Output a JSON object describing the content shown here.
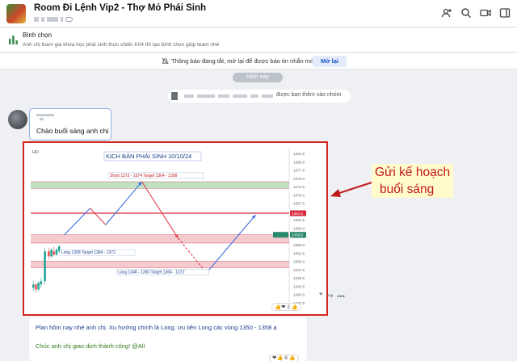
{
  "header": {
    "title": "Room Đi Lệnh Vip2 - Thợ Mỏ Phái Sinh",
    "icons": [
      "add-member-icon",
      "search-icon",
      "video-call-icon",
      "sidebar-toggle-icon"
    ]
  },
  "poll": {
    "title": "Bình chọn",
    "description": "Anh chị tham gia khóa học phái sinh thực chiến K04 thì tạo bình chọn giúp team nhé"
  },
  "notice": {
    "text": "Thông báo đang tắt, mở lại để được báo tin nhắn mới",
    "button": "Mở lại"
  },
  "chat": {
    "date_pill": "Hôm nay",
    "system_message": "được bạn thêm vào nhóm",
    "greeting": "Chào buổi sáng anh chị",
    "annotation": {
      "line1": "Gửi kế hoạch",
      "line2": "buổi sáng"
    },
    "image_reaction": "2",
    "plan_message": "Plan hôm nay nhé anh chị. Xu hướng chính là Long. ưu tiên Long các vùng 1350 - 1358 ạ",
    "wish_message": "Chúc anh chị giao dịch thành công! @All",
    "plan_reaction": "6"
  },
  "chart_data": {
    "type": "line",
    "title": "KỊCH BẢN PHÁI SINH 10/10/24",
    "ylim": [
      1336,
      1384
    ],
    "y_ticks": [
      "1382.5",
      "1380.0",
      "1377.5",
      "1375.0",
      "1372.5",
      "1370.0",
      "1367.5",
      "1365.0",
      "1362.5",
      "1360.0",
      "1357.5",
      "1355.0",
      "1352.5",
      "1350.0",
      "1347.5",
      "1345.0",
      "1342.5",
      "1340.0",
      "1337.5"
    ],
    "price_tags": [
      {
        "label": "1364.5",
        "value": 1364.5,
        "color": "#d8283a"
      },
      {
        "label": "1358.0",
        "value": 1358.0,
        "color": "#2b8a6e"
      }
    ],
    "zones": [
      {
        "name": "Short 1372 - 1374  Target  1364 - 1358",
        "from": 1372,
        "to": 1374,
        "color": "#bfe3c2"
      },
      {
        "name": "Long 1358  Target  1364 - 1372",
        "from": 1355.5,
        "to": 1358,
        "color": "#f6cbd0"
      },
      {
        "name": "Long 1348 - 1350  Target  1364 - 1372",
        "from": 1348,
        "to": 1350,
        "color": "#f6cbd0"
      }
    ],
    "resistance_line": 1364.5,
    "hd_badge": "HD",
    "scenario_path": [
      {
        "x": 0.13,
        "y": 1358
      },
      {
        "x": 0.23,
        "y": 1366
      },
      {
        "x": 0.29,
        "y": 1361
      },
      {
        "x": 0.43,
        "y": 1374
      },
      {
        "x": 0.57,
        "y": 1357
      },
      {
        "x": 0.68,
        "y": 1346.5
      },
      {
        "x": 0.87,
        "y": 1364
      }
    ],
    "dashed_from": 4,
    "dashed_to": 5,
    "candles": [
      {
        "x": 0.01,
        "o": 1342,
        "c": 1343,
        "h": 1344,
        "l": 1341
      },
      {
        "x": 0.02,
        "o": 1343,
        "c": 1341.5,
        "h": 1343.5,
        "l": 1340.5
      },
      {
        "x": 0.03,
        "o": 1341.5,
        "c": 1343.5,
        "h": 1344,
        "l": 1341
      },
      {
        "x": 0.04,
        "o": 1343,
        "c": 1344,
        "h": 1345,
        "l": 1342
      },
      {
        "x": 0.055,
        "o": 1344,
        "c": 1353,
        "h": 1354,
        "l": 1343
      },
      {
        "x": 0.07,
        "o": 1353,
        "c": 1351.5,
        "h": 1354,
        "l": 1350.5
      },
      {
        "x": 0.08,
        "o": 1351.5,
        "c": 1353.5,
        "h": 1354,
        "l": 1351
      },
      {
        "x": 0.09,
        "o": 1353,
        "c": 1352,
        "h": 1354.5,
        "l": 1351.5
      },
      {
        "x": 0.1,
        "o": 1352,
        "c": 1353.5,
        "h": 1354,
        "l": 1351.5
      },
      {
        "x": 0.11,
        "o": 1353,
        "c": 1354.5,
        "h": 1355,
        "l": 1352.5
      }
    ],
    "grid": false
  }
}
